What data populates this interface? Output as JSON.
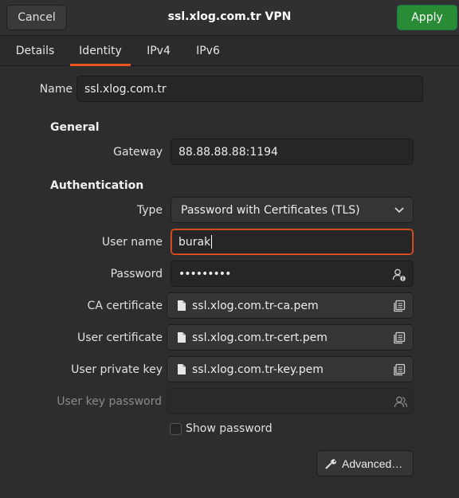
{
  "header": {
    "title": "ssl.xlog.com.tr VPN",
    "cancel_label": "Cancel",
    "apply_label": "Apply"
  },
  "tabs": [
    {
      "label": "Details"
    },
    {
      "label": "Identity"
    },
    {
      "label": "IPv4"
    },
    {
      "label": "IPv6"
    }
  ],
  "name": {
    "label": "Name",
    "value": "ssl.xlog.com.tr"
  },
  "general": {
    "heading": "General",
    "gateway_label": "Gateway",
    "gateway_value": "88.88.88.88:1194"
  },
  "auth": {
    "heading": "Authentication",
    "type_label": "Type",
    "type_value": "Password with Certificates (TLS)",
    "username_label": "User name",
    "username_value": "burak",
    "password_label": "Password",
    "password_value": "•••••••••",
    "ca_label": "CA certificate",
    "ca_value": "ssl.xlog.com.tr-ca.pem",
    "user_cert_label": "User certificate",
    "user_cert_value": "ssl.xlog.com.tr-cert.pem",
    "private_key_label": "User private key",
    "private_key_value": "ssl.xlog.com.tr-key.pem",
    "key_password_label": "User key password",
    "key_password_value": "",
    "show_password_label": "Show password",
    "show_password_checked": false,
    "advanced_label": "Advanced…"
  },
  "icons": {
    "dropdown": "chevron-down-icon",
    "password_options": "user-info-icon",
    "file": "file-icon",
    "browse": "browse-files-icon",
    "advanced": "wrench-icon"
  },
  "colors": {
    "accent": "#e95420",
    "apply": "#2a8b35",
    "background": "#2d2d2d"
  }
}
